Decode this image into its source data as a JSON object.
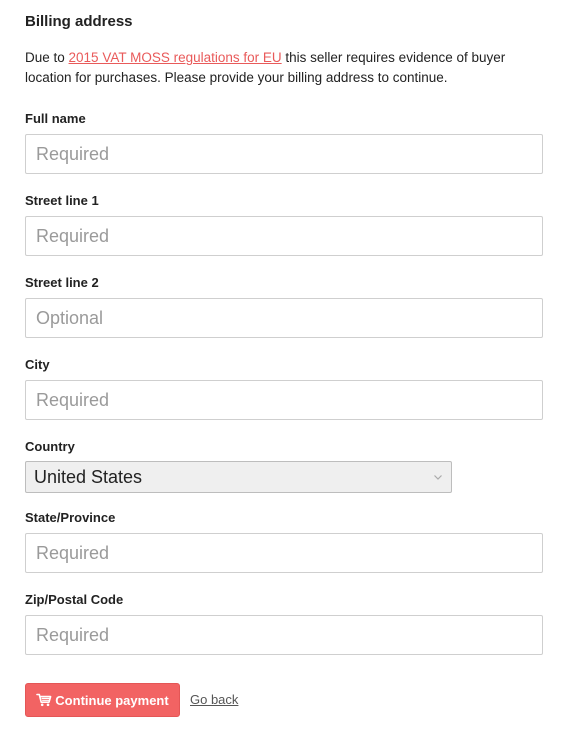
{
  "title": "Billing address",
  "intro": {
    "before": "Due to ",
    "link": "2015 VAT MOSS regulations for EU",
    "after": " this seller requires evidence of buyer location for purchases. Please provide your billing address to continue."
  },
  "fields": {
    "full_name": {
      "label": "Full name",
      "placeholder": "Required",
      "value": ""
    },
    "street1": {
      "label": "Street line 1",
      "placeholder": "Required",
      "value": ""
    },
    "street2": {
      "label": "Street line 2",
      "placeholder": "Optional",
      "value": ""
    },
    "city": {
      "label": "City",
      "placeholder": "Required",
      "value": ""
    },
    "country": {
      "label": "Country",
      "selected": "United States"
    },
    "state": {
      "label": "State/Province",
      "placeholder": "Required",
      "value": ""
    },
    "zip": {
      "label": "Zip/Postal Code",
      "placeholder": "Required",
      "value": ""
    }
  },
  "actions": {
    "continue_label": "Continue payment",
    "continue_icon": "cart-icon",
    "back_label": "Go back"
  },
  "colors": {
    "accent": "#f26363",
    "link": "#e95a5a",
    "placeholder": "#9a9a9a",
    "border": "#cfcfcf"
  }
}
